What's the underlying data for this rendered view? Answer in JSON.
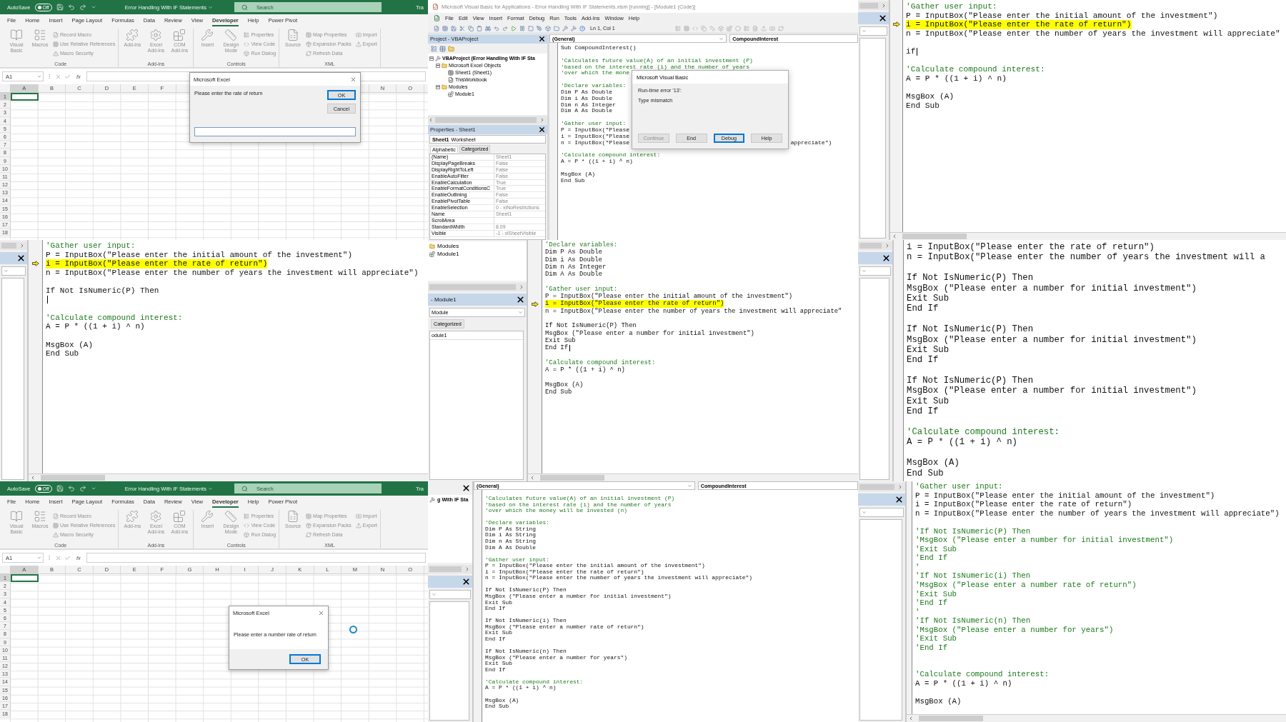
{
  "panels": [
    {
      "kind": "excel",
      "autosave": {
        "label": "AutoSave",
        "state": "Off",
        "on": false
      },
      "document_title": "Error Handling With IF Statements",
      "search": {
        "placeholder": "Search"
      },
      "cut_label": "Tra",
      "tabs": [
        {
          "label": "File",
          "selected": false
        },
        {
          "label": "Home",
          "selected": false
        },
        {
          "label": "Insert",
          "selected": false
        },
        {
          "label": "Page Layout",
          "selected": false
        },
        {
          "label": "Formulas",
          "selected": false
        },
        {
          "label": "Data",
          "selected": false
        },
        {
          "label": "Review",
          "selected": false
        },
        {
          "label": "View",
          "selected": false
        },
        {
          "label": "Developer",
          "selected": true
        },
        {
          "label": "Help",
          "selected": false
        },
        {
          "label": "Power Pivot",
          "selected": false
        }
      ],
      "ribbon": [
        {
          "label": "Code",
          "large": [
            "Visual Basic",
            "Macros"
          ],
          "small": [
            "Record Macro",
            "Use Relative References",
            "Macro Security"
          ]
        },
        {
          "label": "Add-ins",
          "large": [
            "Add-ins",
            "Excel Add-ins",
            "COM Add-ins"
          ]
        },
        {
          "label": "Controls",
          "large": [
            "Insert",
            "Design Mode"
          ],
          "small": [
            "Properties",
            "View Code",
            "Run Dialog"
          ]
        },
        {
          "label": "XML",
          "large": [
            "Source"
          ],
          "small": [
            "Map Properties",
            "Expansion Packs",
            "Refresh Data",
            "Import",
            "Export"
          ]
        }
      ],
      "name_box": "A1",
      "function_label": "fx",
      "columns": [
        "A",
        "B",
        "C",
        "D",
        "E",
        "F"
      ],
      "columns_right": [
        "N",
        "O"
      ],
      "rows": [
        "1",
        "2",
        "3",
        "4",
        "5",
        "6",
        "7",
        "8",
        "9",
        "10",
        "11",
        "12",
        "13",
        "14",
        "15",
        "16",
        "17",
        "18"
      ],
      "dialog": {
        "kind": "input",
        "title": "Microsoft Excel",
        "prompt": "Please enter the rate of return",
        "buttons": [
          {
            "label": "OK",
            "default": true
          },
          {
            "label": "Cancel",
            "default": false
          }
        ]
      }
    },
    {
      "kind": "vbe",
      "title": "Microsoft Visual Basic for Applications - Error Handling With IF Statements.xlsm [running] - [Module1 (Code)]",
      "menu": [
        "File",
        "Edit",
        "View",
        "Insert",
        "Format",
        "Debug",
        "Run",
        "Tools",
        "Add-Ins",
        "Window",
        "Help"
      ],
      "position": "Ln 1, Col 1",
      "project": {
        "title": "Project - VBAProject",
        "tree": [
          {
            "label": "VBAProject (Error Handling With IF Sta",
            "kind": "project",
            "expanded": true,
            "children": [
              {
                "label": "Microsoft Excel Objects",
                "kind": "folder",
                "expanded": true,
                "children": [
                  {
                    "label": "Sheet1 (Sheet1)",
                    "kind": "sheet"
                  },
                  {
                    "label": "ThisWorkbook",
                    "kind": "workbook"
                  }
                ]
              },
              {
                "label": "Modules",
                "kind": "folder",
                "expanded": true,
                "children": [
                  {
                    "label": "Module1",
                    "kind": "module"
                  }
                ]
              }
            ]
          }
        ]
      },
      "properties": {
        "title": "Properties - Sheet1",
        "object_name": "Sheet1",
        "object_type": "Worksheet",
        "tabs": [
          {
            "label": "Alphabetic",
            "selected": true
          },
          {
            "label": "Categorized",
            "selected": false
          }
        ],
        "rows": [
          {
            "name": "(Name)",
            "value": "Sheet1"
          },
          {
            "name": "DisplayPageBreaks",
            "value": "False"
          },
          {
            "name": "DisplayRightToLeft",
            "value": "False"
          },
          {
            "name": "EnableAutoFilter",
            "value": "False"
          },
          {
            "name": "EnableCalculation",
            "value": "True"
          },
          {
            "name": "EnableFormatConditionsC",
            "value": "True"
          },
          {
            "name": "EnableOutlining",
            "value": "False"
          },
          {
            "name": "EnablePivotTable",
            "value": "False"
          },
          {
            "name": "EnableSelection",
            "value": "0 - xlNoRestrictions"
          },
          {
            "name": "Name",
            "value": "Sheet1"
          },
          {
            "name": "ScrollArea"
          },
          {
            "name": "StandardWidth",
            "value": "8.09"
          },
          {
            "name": "Visible",
            "value": "-1 - xlSheetVisible"
          }
        ]
      },
      "code": {
        "scope": "(General)",
        "procedure": "CompoundInterest",
        "lines": [
          {
            "kind": "code",
            "text": "Sub CompoundInterest()"
          },
          {
            "kind": "blank"
          },
          {
            "kind": "comment",
            "text": "'Calculates future value(A) of an initial investment (P)"
          },
          {
            "kind": "comment",
            "text": "'based on the interest rate (i) and the number of years"
          },
          {
            "kind": "comment",
            "text": "'over which the mone"
          },
          {
            "kind": "blank"
          },
          {
            "kind": "comment",
            "text": "'Declare variables:"
          },
          {
            "kind": "code",
            "text": "Dim P As Double"
          },
          {
            "kind": "code",
            "text": "Dim i As Double"
          },
          {
            "kind": "code",
            "text": "Dim n As Integer"
          },
          {
            "kind": "code",
            "text": "Dim A As Double"
          },
          {
            "kind": "blank"
          },
          {
            "kind": "comment",
            "text": "'Gather user input:"
          },
          {
            "kind": "code",
            "text": "P = InputBox(\"Please"
          },
          {
            "kind": "code",
            "text": "i = InputBox(\"Please"
          },
          {
            "kind": "code",
            "text": "n = InputBox(\"Please",
            "tail": "appreciate\")"
          },
          {
            "kind": "blank"
          },
          {
            "kind": "comment",
            "text": "'Calculate compound interest:"
          },
          {
            "kind": "code",
            "text": "A = P * ((1 + i) ^ n)"
          },
          {
            "kind": "blank"
          },
          {
            "kind": "code",
            "text": "MsgBox (A)"
          },
          {
            "kind": "code",
            "text": "End Sub"
          }
        ]
      },
      "dialog": {
        "title": "Microsoft Visual Basic",
        "error": "Run-time error '13':",
        "message": "Type mismatch",
        "buttons": [
          {
            "label": "Continue",
            "disabled": true,
            "default": false
          },
          {
            "label": "End",
            "disabled": false,
            "default": false
          },
          {
            "label": "Debug",
            "disabled": false,
            "default": true
          },
          {
            "label": "Help",
            "disabled": false,
            "default": false
          }
        ]
      }
    },
    {
      "kind": "code",
      "sidebar": [
        {
          "kind": "scroll"
        },
        {
          "kind": "title"
        },
        {
          "kind": "dropdown"
        },
        {
          "kind": "list"
        }
      ],
      "lines": [
        {
          "kind": "comment",
          "text": "'Gather user input:"
        },
        {
          "kind": "code",
          "text": "P = InputBox(\"Please enter the initial amount of the investment\")"
        },
        {
          "kind": "current",
          "text": "i = InputBox(\"Please enter the rate of return\")"
        },
        {
          "kind": "code",
          "text": "n = InputBox(\"Please enter the number of years the investment will appreciate\""
        },
        {
          "kind": "blank"
        },
        {
          "kind": "typing",
          "text": "if"
        },
        {
          "kind": "blank"
        },
        {
          "kind": "comment",
          "text": "'Calculate compound interest:"
        },
        {
          "kind": "code",
          "text": "A = P * ((1 + i) ^ n)"
        },
        {
          "kind": "blank"
        },
        {
          "kind": "code",
          "text": "MsgBox (A)"
        },
        {
          "kind": "code",
          "text": "End Sub"
        }
      ]
    },
    {
      "kind": "code",
      "sidebar": [
        {
          "kind": "scroll"
        },
        {
          "kind": "title"
        },
        {
          "kind": "dropdown"
        },
        {
          "kind": "list"
        }
      ],
      "lines": [
        {
          "kind": "comment",
          "text": "'Gather user input:"
        },
        {
          "kind": "code",
          "text": "P = InputBox(\"Please enter the initial amount of the investment\")"
        },
        {
          "kind": "current",
          "text": "i = InputBox(\"Please enter the rate of return\")"
        },
        {
          "kind": "code",
          "text": "n = InputBox(\"Please enter the number of years the investment will appreciate\")"
        },
        {
          "kind": "blank"
        },
        {
          "kind": "code",
          "text": "If Not IsNumeric(P) Then"
        },
        {
          "kind": "typing"
        },
        {
          "kind": "blank"
        },
        {
          "kind": "comment",
          "text": "'Calculate compound interest:"
        },
        {
          "kind": "code",
          "text": "A = P * ((1 + i) ^ n)"
        },
        {
          "kind": "blank"
        },
        {
          "kind": "code",
          "text": "MsgBox (A)"
        },
        {
          "kind": "code",
          "text": "End Sub"
        }
      ]
    },
    {
      "kind": "code",
      "sidebar": [
        {
          "kind": "tree",
          "items": [
            {
              "label": "Modules",
              "kind": "folder"
            },
            {
              "label": "Module1",
              "kind": "module"
            }
          ]
        },
        {
          "kind": "scroll"
        },
        {
          "kind": "title",
          "label": "- Module1"
        },
        {
          "kind": "dropdown",
          "label": "Module"
        },
        {
          "kind": "tab",
          "label": "Categorized"
        },
        {
          "kind": "list",
          "rows": [
            "odule1"
          ]
        }
      ],
      "lines": [
        {
          "kind": "comment",
          "text": "'Declare variables:"
        },
        {
          "kind": "code",
          "text": "Dim P As Double"
        },
        {
          "kind": "code",
          "text": "Dim i As Double"
        },
        {
          "kind": "code",
          "text": "Dim n As Integer"
        },
        {
          "kind": "code",
          "text": "Dim A As Double"
        },
        {
          "kind": "blank"
        },
        {
          "kind": "comment",
          "text": "'Gather user input:"
        },
        {
          "kind": "code",
          "text": "P = InputBox(\"Please enter the initial amount of the investment\")"
        },
        {
          "kind": "current",
          "text": "i = InputBox(\"Please enter the rate of return\")"
        },
        {
          "kind": "code",
          "text": "n = InputBox(\"Please enter the number of years the investment will appreciate\""
        },
        {
          "kind": "blank"
        },
        {
          "kind": "code",
          "text": "If Not IsNumeric(P) Then"
        },
        {
          "kind": "code",
          "text": "MsgBox (\"Please enter a number for initial investment\")"
        },
        {
          "kind": "code",
          "text": "Exit Sub"
        },
        {
          "kind": "typing",
          "text": "End If"
        },
        {
          "kind": "blank"
        },
        {
          "kind": "comment",
          "text": "'Calculate compound interest:"
        },
        {
          "kind": "code",
          "text": "A = P * ((1 + i) ^ n)"
        },
        {
          "kind": "blank"
        },
        {
          "kind": "code",
          "text": "MsgBox (A)"
        },
        {
          "kind": "code",
          "text": "End Sub"
        }
      ]
    },
    {
      "kind": "code",
      "sidebar": [
        {
          "kind": "scroll"
        },
        {
          "kind": "title"
        },
        {
          "kind": "dropdown"
        },
        {
          "kind": "list"
        }
      ],
      "lines": [
        {
          "kind": "code",
          "text": "i = InputBox(\"Please enter the rate of return\")"
        },
        {
          "kind": "code",
          "text": "n = InputBox(\"Please enter the number of years the investment will a"
        },
        {
          "kind": "blank"
        },
        {
          "kind": "code",
          "text": "If Not IsNumeric(P) Then"
        },
        {
          "kind": "code",
          "text": "MsgBox (\"Please enter a number for initial investment\")"
        },
        {
          "kind": "code",
          "text": "Exit Sub"
        },
        {
          "kind": "code",
          "text": "End If"
        },
        {
          "kind": "blank"
        },
        {
          "kind": "code",
          "text": "If Not IsNumeric(P) Then"
        },
        {
          "kind": "code",
          "text": "MsgBox (\"Please enter a number for initial investment\")"
        },
        {
          "kind": "code",
          "text": "Exit Sub"
        },
        {
          "kind": "code",
          "text": "End If"
        },
        {
          "kind": "blank"
        },
        {
          "kind": "code",
          "text": "If Not IsNumeric(P) Then"
        },
        {
          "kind": "code",
          "text": "MsgBox (\"Please enter a number for initial investment\")"
        },
        {
          "kind": "code",
          "text": "Exit Sub"
        },
        {
          "kind": "code",
          "text": "End If"
        },
        {
          "kind": "blank"
        },
        {
          "kind": "comment",
          "text": "'Calculate compound interest:"
        },
        {
          "kind": "code",
          "text": "A = P * ((1 + i) ^ n)"
        },
        {
          "kind": "blank"
        },
        {
          "kind": "code",
          "text": "MsgBox (A)"
        },
        {
          "kind": "code",
          "text": "End Sub"
        }
      ]
    },
    {
      "kind": "excel",
      "autosave": {
        "label": "AutoSave",
        "state": "Off",
        "on": false
      },
      "document_title": "Error Handling With IF Statements",
      "search": {
        "placeholder": "Search"
      },
      "cut_label": "Tra",
      "tabs": [
        {
          "label": "File",
          "selected": false
        },
        {
          "label": "Home",
          "selected": false
        },
        {
          "label": "Insert",
          "selected": false
        },
        {
          "label": "Page Layout",
          "selected": false
        },
        {
          "label": "Formulas",
          "selected": false
        },
        {
          "label": "Data",
          "selected": false
        },
        {
          "label": "Review",
          "selected": false
        },
        {
          "label": "View",
          "selected": false
        },
        {
          "label": "Developer",
          "selected": true
        },
        {
          "label": "Help",
          "selected": false
        },
        {
          "label": "Power Pivot",
          "selected": false
        }
      ],
      "ribbon": [
        {
          "label": "Code",
          "large": [
            "Visual Basic",
            "Macros"
          ],
          "small": [
            "Record Macro",
            "Use Relative References",
            "Macro Security"
          ]
        },
        {
          "label": "Add-ins",
          "large": [
            "Add-ins",
            "Excel Add-ins",
            "COM Add-ins"
          ]
        },
        {
          "label": "Controls",
          "large": [
            "Insert",
            "Design Mode"
          ],
          "small": [
            "Properties",
            "View Code",
            "Run Dialog"
          ]
        },
        {
          "label": "XML",
          "large": [
            "Source"
          ],
          "small": [
            "Map Properties",
            "Expansion Packs",
            "Refresh Data",
            "Import",
            "Export"
          ]
        }
      ],
      "name_box": "A1",
      "function_label": "fx",
      "columns": [
        "A",
        "B",
        "C",
        "D",
        "E",
        "F",
        "G",
        "H",
        "I",
        "J",
        "K",
        "L",
        "M",
        "N",
        "O"
      ],
      "rows": [
        "1",
        "2",
        "3",
        "4",
        "5",
        "6",
        "7",
        "8",
        "9",
        "10",
        "11",
        "12",
        "13",
        "14",
        "15",
        "16",
        "17",
        "18"
      ],
      "dialog": {
        "kind": "message",
        "title": "Microsoft Excel",
        "prompt": "Please enter a number rate of return",
        "buttons": [
          {
            "label": "OK",
            "default": true
          }
        ]
      }
    },
    {
      "kind": "code",
      "sidebar": [
        {
          "kind": "close"
        },
        {
          "kind": "tree",
          "items": [
            {
              "label": "g With IF Sta",
              "kind": "project"
            }
          ]
        },
        {
          "kind": "scroll"
        },
        {
          "kind": "title"
        },
        {
          "kind": "dropdown"
        },
        {
          "kind": "list"
        }
      ],
      "header": {
        "scope": "(General)",
        "procedure": "CompoundInterest"
      },
      "lines": [
        {
          "kind": "comment",
          "text": "'Calculates future value(A) of an initial investment (P)"
        },
        {
          "kind": "comment",
          "text": "'based on the interest rate (i) and the number of years"
        },
        {
          "kind": "comment",
          "text": "'over which the money will be invested (n)"
        },
        {
          "kind": "blank"
        },
        {
          "kind": "comment",
          "text": "'Declare variables:"
        },
        {
          "kind": "code",
          "text": "Dim P As String"
        },
        {
          "kind": "code",
          "text": "Dim i As String"
        },
        {
          "kind": "code",
          "text": "Dim n As String"
        },
        {
          "kind": "code",
          "text": "Dim A As Double"
        },
        {
          "kind": "blank"
        },
        {
          "kind": "comment",
          "text": "'Gather user input:"
        },
        {
          "kind": "code",
          "text": "P = InputBox(\"Please enter the initial amount of the investment\")"
        },
        {
          "kind": "code",
          "text": "i = InputBox(\"Please enter the rate of return\")"
        },
        {
          "kind": "code",
          "text": "n = InputBox(\"Please enter the number of years the investment will appreciate\")"
        },
        {
          "kind": "blank"
        },
        {
          "kind": "code",
          "text": "If Not IsNumeric(P) Then"
        },
        {
          "kind": "code",
          "text": "MsgBox (\"Please enter a number for initial investment\")"
        },
        {
          "kind": "code",
          "text": "Exit Sub"
        },
        {
          "kind": "code",
          "text": "End If"
        },
        {
          "kind": "blank"
        },
        {
          "kind": "code",
          "text": "If Not IsNumeric(i) Then"
        },
        {
          "kind": "code",
          "text": "MsgBox (\"Please enter a number rate of return\")"
        },
        {
          "kind": "code",
          "text": "Exit Sub"
        },
        {
          "kind": "code",
          "text": "End If"
        },
        {
          "kind": "blank"
        },
        {
          "kind": "code",
          "text": "If Not IsNumeric(n) Then"
        },
        {
          "kind": "code",
          "text": "MsgBox (\"Please enter a number for years\")"
        },
        {
          "kind": "code",
          "text": "Exit Sub"
        },
        {
          "kind": "code",
          "text": "End If"
        },
        {
          "kind": "blank"
        },
        {
          "kind": "comment",
          "text": "'Calculate compound interest:"
        },
        {
          "kind": "code",
          "text": "A = P * ((1 + i) ^ n)"
        },
        {
          "kind": "blank"
        },
        {
          "kind": "code",
          "text": "MsgBox (A)"
        },
        {
          "kind": "code",
          "text": "End Sub"
        }
      ]
    },
    {
      "kind": "code",
      "sidebar": [
        {
          "kind": "scroll"
        },
        {
          "kind": "title"
        },
        {
          "kind": "dropdown"
        },
        {
          "kind": "list"
        }
      ],
      "lines": [
        {
          "kind": "comment",
          "text": "'Gather user input:"
        },
        {
          "kind": "code",
          "text": "P = InputBox(\"Please enter the initial amount of the investment\")"
        },
        {
          "kind": "code",
          "text": "i = InputBox(\"Please enter the rate of return\")"
        },
        {
          "kind": "code",
          "text": "n = InputBox(\"Please enter the number of years the investment will appreciate\")"
        },
        {
          "kind": "blank"
        },
        {
          "kind": "comment",
          "text": "'If Not IsNumeric(P) Then"
        },
        {
          "kind": "comment",
          "text": "'MsgBox (\"Please enter a number for initial investment\")"
        },
        {
          "kind": "comment",
          "text": "'Exit Sub"
        },
        {
          "kind": "comment",
          "text": "'End If"
        },
        {
          "kind": "comment",
          "text": "'"
        },
        {
          "kind": "comment",
          "text": "'If Not IsNumeric(i) Then"
        },
        {
          "kind": "comment",
          "text": "'MsgBox (\"Please enter a number rate of return\")"
        },
        {
          "kind": "comment",
          "text": "'Exit Sub"
        },
        {
          "kind": "comment",
          "text": "'End If"
        },
        {
          "kind": "comment",
          "text": "'"
        },
        {
          "kind": "comment",
          "text": "'If Not IsNumeric(n) Then"
        },
        {
          "kind": "comment",
          "text": "'MsgBox (\"Please enter a number for years\")"
        },
        {
          "kind": "comment",
          "text": "'Exit Sub"
        },
        {
          "kind": "comment",
          "text": "'End If"
        },
        {
          "kind": "blank"
        },
        {
          "kind": "blank"
        },
        {
          "kind": "comment",
          "text": "'Calculate compound interest:"
        },
        {
          "kind": "code",
          "text": "A = P * ((1 + i) ^ n)"
        },
        {
          "kind": "blank"
        },
        {
          "kind": "code",
          "text": "MsgBox (A)"
        }
      ]
    }
  ]
}
